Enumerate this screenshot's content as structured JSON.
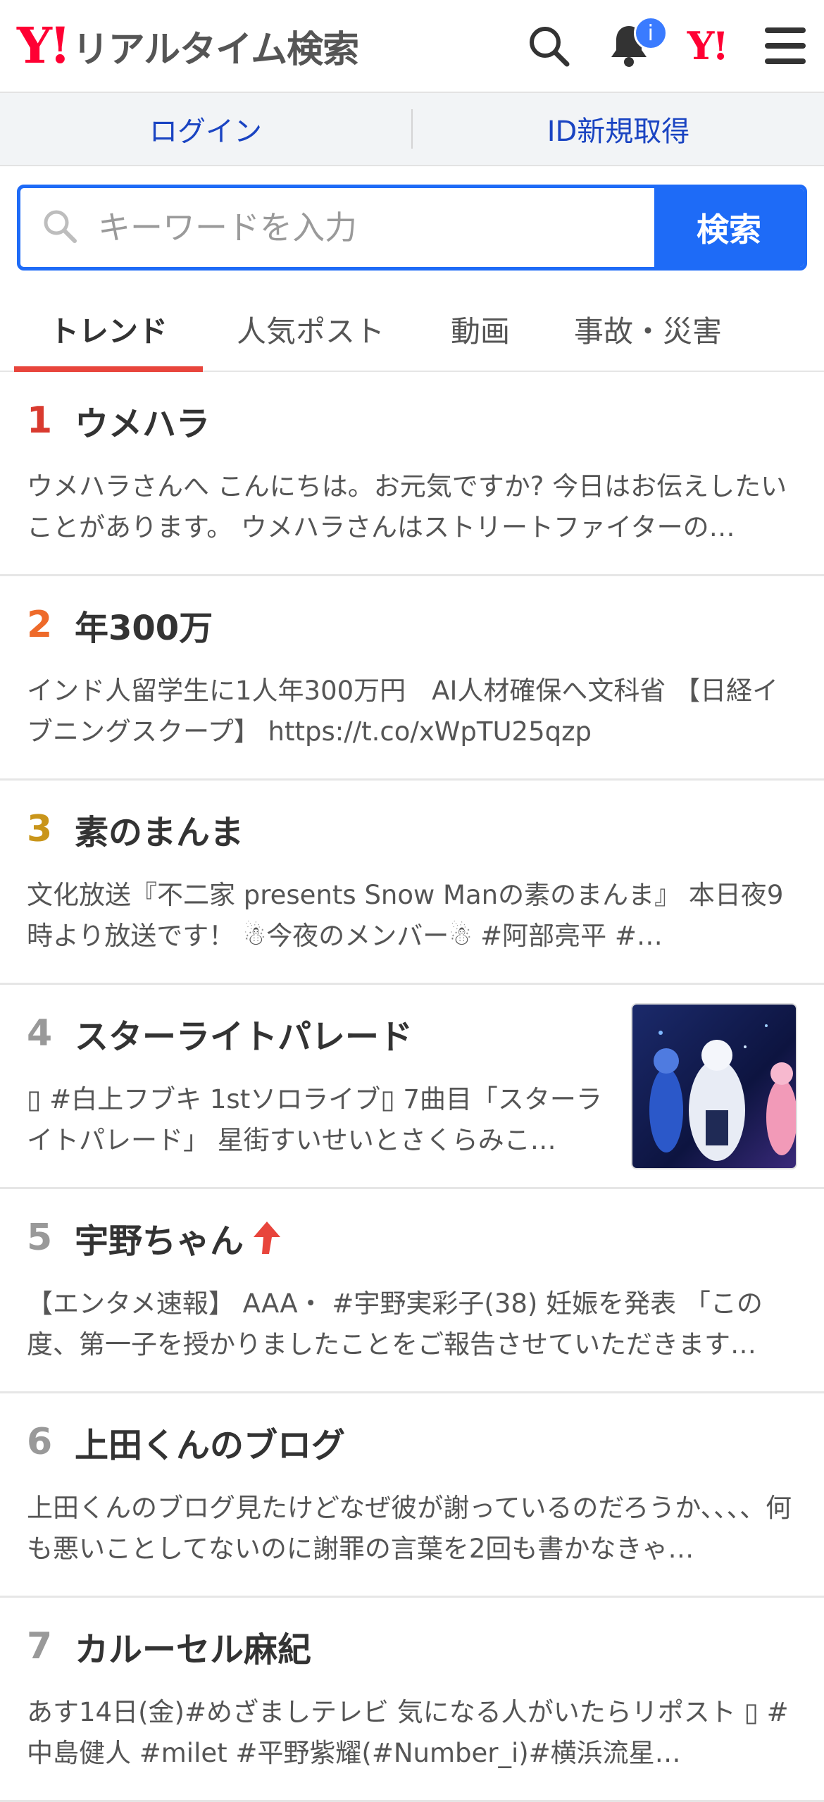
{
  "header": {
    "logo_mark": "Y!",
    "logo_text": "リアルタイム検索",
    "notification_badge": "i",
    "yj_mark": "Y!"
  },
  "loginbar": {
    "login": "ログイン",
    "register": "ID新規取得"
  },
  "search": {
    "placeholder": "キーワードを入力",
    "button": "検索"
  },
  "tabs": [
    {
      "label": "トレンド",
      "active": true
    },
    {
      "label": "人気ポスト",
      "active": false
    },
    {
      "label": "動画",
      "active": false
    },
    {
      "label": "事故・災害",
      "active": false
    }
  ],
  "trends": [
    {
      "rank": "1",
      "title": "ウメハラ",
      "desc": "ウメハラさんへ こんにちは。お元気ですか? 今日はお伝えしたいことがあります。 ウメハラさんはストリートファイターの…",
      "rank_color": "#d93a2f"
    },
    {
      "rank": "2",
      "title": "年300万",
      "desc": "インド人留学生に1人年300万円　AI人材確保へ文科省 【日経イブニングスクープ】 https://t.co/xWpTU25qzp",
      "rank_color": "#ee6a2a"
    },
    {
      "rank": "3",
      "title": "素のまんま",
      "desc": "文化放送『不二家 presents Snow Manの素のまんま』 本日夜9時より放送です！ ☃今夜のメンバー☃ #阿部亮平 #…",
      "rank_color": "#c9951a"
    },
    {
      "rank": "4",
      "title": "スターライトパレード",
      "desc": "▯ #白上フブキ 1stソロライブ▯ 7曲目「スターライトパレード」 星街すいせいとさくらみこ…",
      "rank_color": "#999999",
      "has_thumb": true
    },
    {
      "rank": "5",
      "title": "宇野ちゃん",
      "desc": "【エンタメ速報】 AAA・ #宇野実彩子(38) 妊娠を発表 「この度、第一子を授かりましたことをご報告させていただきます…",
      "rank_color": "#999999",
      "rising": true
    },
    {
      "rank": "6",
      "title": "上田くんのブログ",
      "desc": "上田くんのブログ見たけどなぜ彼が謝っているのだろうか、、、、何も悪いことしてないのに謝罪の言葉を2回も書かなきゃ…",
      "rank_color": "#999999"
    },
    {
      "rank": "7",
      "title": "カルーセル麻紀",
      "desc": "あす14日(金)#めざましテレビ 気になる人がいたらリポスト ▯ #中島健人 #milet #平野紫耀(#Number_i)#横浜流星…",
      "rank_color": "#999999"
    }
  ],
  "colors": {
    "brand_red": "#ff0033",
    "accent_blue": "#1e6bf7",
    "tab_underline": "#e8453c",
    "rising_arrow": "#e8453c"
  }
}
